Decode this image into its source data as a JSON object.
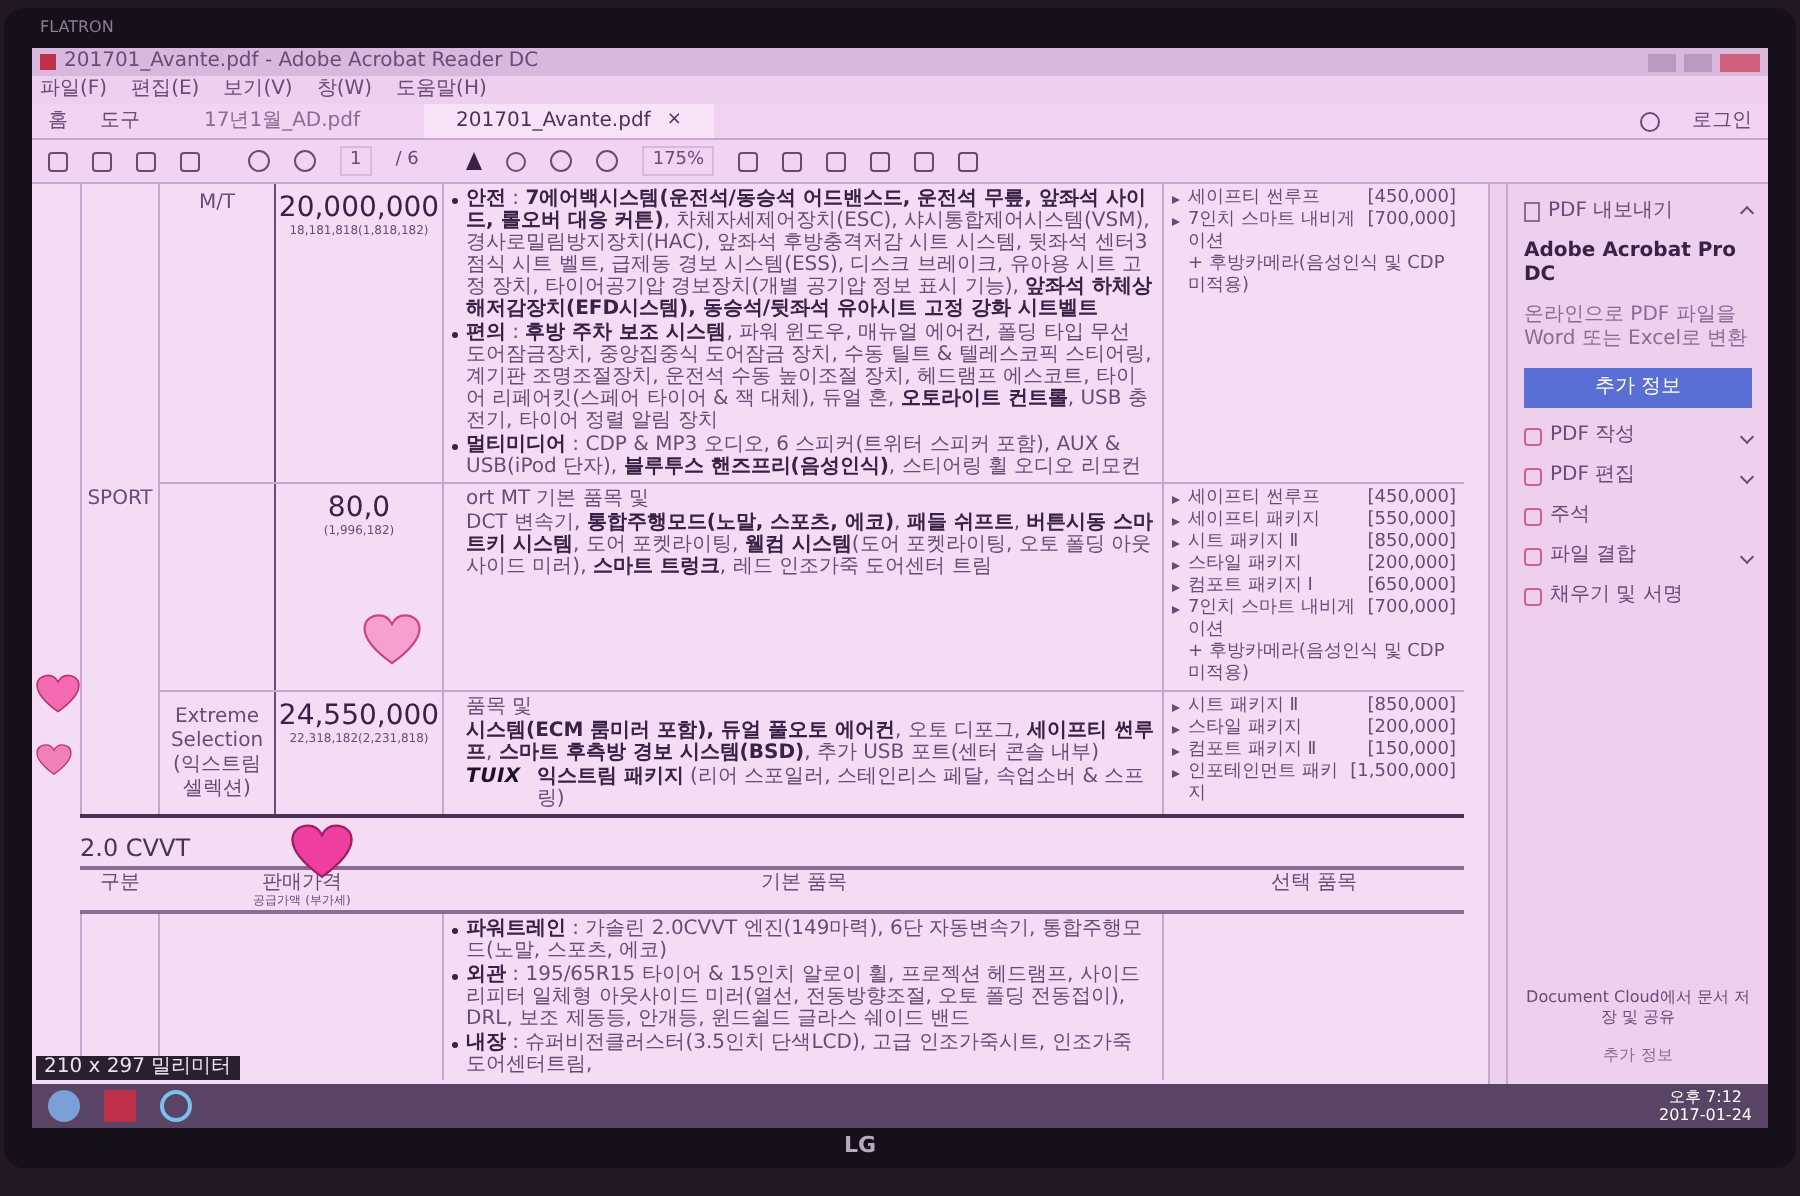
{
  "monitor": {
    "brand_top": "FLATRON",
    "brand_bottom": "LG"
  },
  "window": {
    "title": "201701_Avante.pdf - Adobe Acrobat Reader DC"
  },
  "menu": [
    "파일(F)",
    "편집(E)",
    "보기(V)",
    "창(W)",
    "도움말(H)"
  ],
  "tabs": {
    "home": "홈",
    "tools": "도구",
    "documents": [
      {
        "label": "17년1월_AD.pdf",
        "selected": false
      },
      {
        "label": "201701_Avante.pdf",
        "selected": true,
        "close": "×"
      }
    ],
    "login": "로그인"
  },
  "toolbar": {
    "page": "1",
    "page_total": "/ 6",
    "zoom": "175%"
  },
  "table1": {
    "groups": [
      {
        "trim": "SPORT",
        "subrows": [
          {
            "type": "M/T",
            "price": "20,000,000",
            "price_note": "18,181,818(1,818,182)",
            "basic": [
              {
                "kind": "bullet",
                "text": "**안전** : **7에어백시스템(운전석/동승석 어드밴스드, 운전석 무릎, 앞좌석 사이드, 롤오버 대응 커튼)**, 차체자세제어장치(ESC), 샤시통합제어시스템(VSM), 경사로밀림방지장치(HAC), 앞좌석 후방충격저감 시트 시스템, 뒷좌석 센터3점식 시트 벨트, 급제동 경보 시스템(ESS), 디스크 브레이크, 유아용 시트 고정 장치, 타이어공기압 경보장치(개별 공기압 정보 표시 기능), **앞좌석 하체상해저감장치(EFD시스템), 동승석/뒷좌석 유아시트 고정 강화 시트벨트**"
              },
              {
                "kind": "bullet",
                "text": "**편의** : **후방 주차 보조 시스템**, 파워 윈도우, 매뉴얼 에어컨, 폴딩 타입 무선 도어잠금장치, 중앙집중식 도어잠금 장치, 수동 틸트 & 텔레스코픽 스티어링, 계기판 조명조절장치, 운전석 수동 높이조절 장치, 헤드램프 에스코트, 타이어 리페어킷(스페어 타이어 & 잭 대체), 듀얼 혼, **오토라이트 컨트롤**, USB 충전기, 타이어 정렬 알림 장치"
              },
              {
                "kind": "bullet",
                "text": "**멀티미디어** : CDP & MP3 오디오, 6 스피커(트위터 스피커 포함), AUX & USB(iPod 단자), **블루투스 핸즈프리(음성인식)**, 스티어링 휠 오디오 리모컨"
              }
            ],
            "options": [
              {
                "kind": "item",
                "name": "세이프티 썬루프",
                "price": "[450,000]"
              },
              {
                "kind": "item",
                "name": "7인치 스마트 내비게이션",
                "price": "[700,000]"
              },
              {
                "kind": "note",
                "name": "+ 후방카메라(음성인식 및 CDP 미적용)"
              }
            ]
          },
          {
            "price": "80,0",
            "price_note": "(1,996,182)",
            "basic": [
              {
                "kind": "plain",
                "text": "ort MT 기본 품목 및"
              },
              {
                "kind": "plain",
                "text": "DCT 변속기, **통합주행모드(노말, 스포츠, 에코)**, **패들 쉬프트**, **버튼시동 스마트키 시스템**, 도어 포켓라이팅, **웰컴 시스템**(도어 포켓라이팅, 오토 폴딩 아웃사이드 미러), **스마트 트렁크**, 레드 인조가죽 도어센터 트림"
              }
            ],
            "options": [
              {
                "kind": "item",
                "name": "세이프티 썬루프",
                "price": "[450,000]"
              },
              {
                "kind": "item",
                "name": "세이프티 패키지",
                "price": "[550,000]"
              },
              {
                "kind": "item",
                "name": "시트 패키지 Ⅱ",
                "price": "[850,000]"
              },
              {
                "kind": "item",
                "name": "스타일 패키지",
                "price": "[200,000]"
              },
              {
                "kind": "item",
                "name": "컴포트 패키지 Ⅰ",
                "price": "[650,000]"
              },
              {
                "kind": "item",
                "name": "7인치 스마트 내비게이션",
                "price": "[700,000]"
              },
              {
                "kind": "note",
                "name": "+ 후방카메라(음성인식 및 CDP 미적용)"
              }
            ]
          },
          {
            "type": "Extreme Selection (익스트림 셀렉션)",
            "price": "24,550,000",
            "price_note": "22,318,182(2,231,818)",
            "basic": [
              {
                "kind": "plain",
                "text": "품목 및"
              },
              {
                "kind": "plain",
                "text": "**시스템(ECM 룸미러 포함), 듀얼 풀오토 에어컨**, 오토 디포그, **세이프티 썬루프**, **스마트 후측방 경보 시스템(BSD)**, 추가 USB 포트(센터 콘솔 내부)"
              },
              {
                "kind": "brand",
                "brand": "TUIX",
                "text": "**익스트림 패키지** (리어 스포일러, 스테인리스 페달, 속업소버 & 스프링)"
              }
            ],
            "options": [
              {
                "kind": "item",
                "name": "시트 패키지 Ⅱ",
                "price": "[850,000]"
              },
              {
                "kind": "item",
                "name": "스타일 패키지",
                "price": "[200,000]"
              },
              {
                "kind": "item",
                "name": "컴포트 패키지 Ⅱ",
                "price": "[150,000]"
              },
              {
                "kind": "item",
                "name": "인포테인먼트 패키지",
                "price": "[1,500,000]"
              }
            ]
          }
        ]
      }
    ]
  },
  "section2": {
    "heading": "2.0 CVVT",
    "columns": [
      {
        "label": "구분"
      },
      {
        "label": "판매가격",
        "note": "공급가액 (부가세)"
      },
      {
        "label": "기본 품목"
      },
      {
        "label": "선택 품목"
      }
    ],
    "basic": [
      {
        "kind": "bullet",
        "text": "**파워트레인** : 가솔린 2.0CVVT 엔진(149마력), 6단 자동변속기, 통합주행모드(노말, 스포츠, 에코)"
      },
      {
        "kind": "bullet",
        "text": "**외관** : 195/65R15 타이어 & 15인치 알로이 휠, 프로젝션 헤드램프, 사이드 리피터 일체형 아웃사이드 미러(열선, 전동방향조절, 오토 폴딩 전동접이), DRL, 보조 제동등, 안개등, 윈드쉴드 글라스 쉐이드 밴드"
      },
      {
        "kind": "bullet",
        "text": "**내장** : 슈퍼비전클러스터(3.5인치 단색LCD), 고급 인조가죽시트, 인조가죽 도어센터트림,"
      }
    ]
  },
  "page_size_tooltip": "210 x 297 밀리미터",
  "right_pane": {
    "export": "PDF 내보내기",
    "product": "Adobe Acrobat Pro DC",
    "description": "온라인으로 PDF 파일을 Word 또는 Excel로 변환",
    "button": "추가 정보",
    "tools": [
      {
        "label": "PDF 작성",
        "expandable": true
      },
      {
        "label": "PDF 편집",
        "expandable": true
      },
      {
        "label": "주석",
        "expandable": false
      },
      {
        "label": "파일 결합",
        "expandable": true
      },
      {
        "label": "채우기 및 서명",
        "expandable": false
      }
    ],
    "cloud_text": "Document Cloud에서 문서 저장 및 공유",
    "cloud_link": "추가 정보"
  },
  "taskbar": {
    "time": "오후 7:12",
    "date": "2017-01-24"
  }
}
